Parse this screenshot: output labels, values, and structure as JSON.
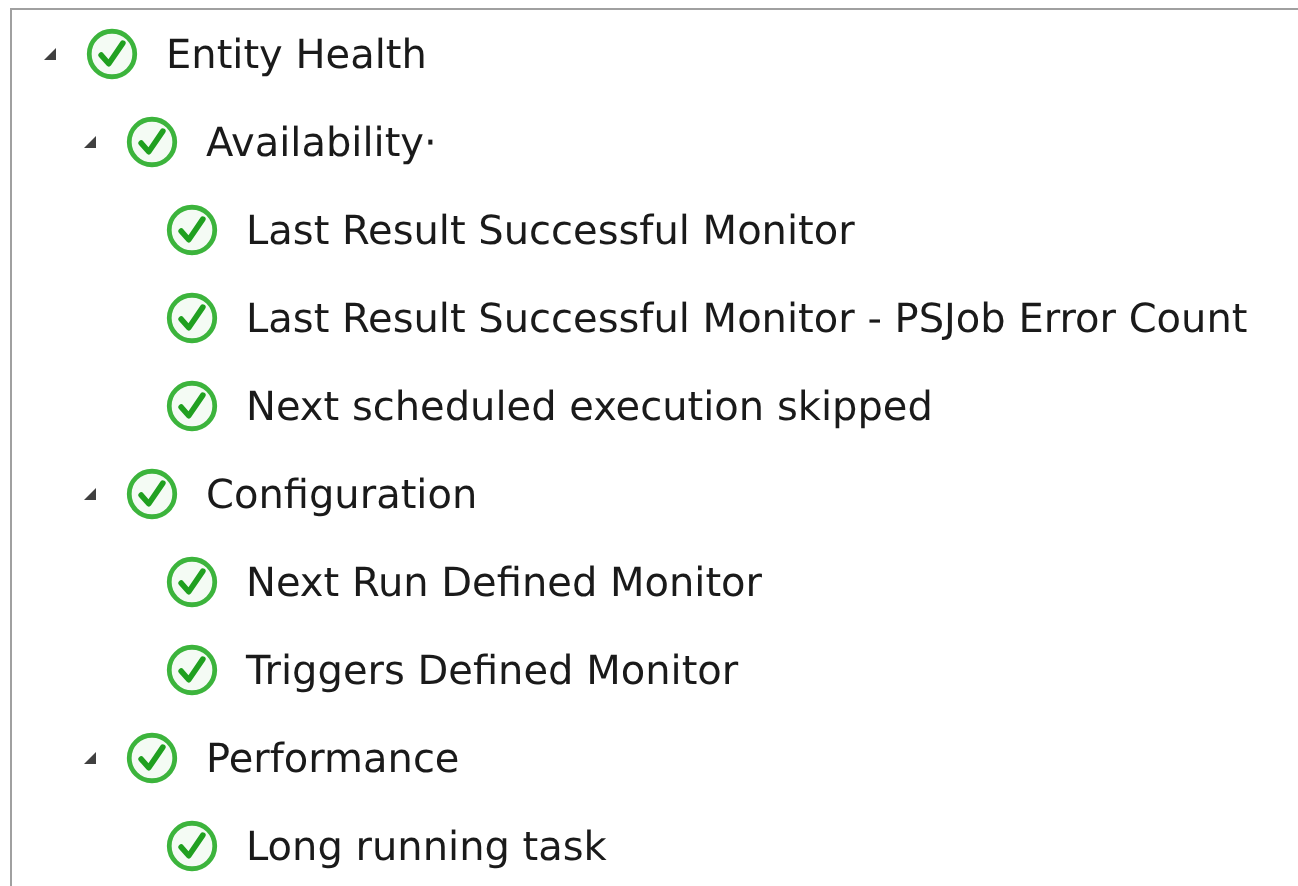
{
  "tree": [
    {
      "label": "Entity Health",
      "healthy": true,
      "expanded": true,
      "children": [
        {
          "label": "Availability·",
          "healthy": true,
          "expanded": true,
          "children": [
            {
              "label": "Last Result Successful Monitor",
              "healthy": true
            },
            {
              "label": "Last Result Successful Monitor - PSJob Error Count",
              "healthy": true
            },
            {
              "label": "Next scheduled execution skipped",
              "healthy": true
            }
          ]
        },
        {
          "label": "Configuration",
          "healthy": true,
          "expanded": true,
          "children": [
            {
              "label": "Next Run Defined Monitor",
              "healthy": true
            },
            {
              "label": "Triggers Defined Monitor",
              "healthy": true
            }
          ]
        },
        {
          "label": "Performance",
          "healthy": true,
          "expanded": true,
          "children": [
            {
              "label": "Long running task",
              "healthy": true
            }
          ]
        }
      ]
    }
  ]
}
